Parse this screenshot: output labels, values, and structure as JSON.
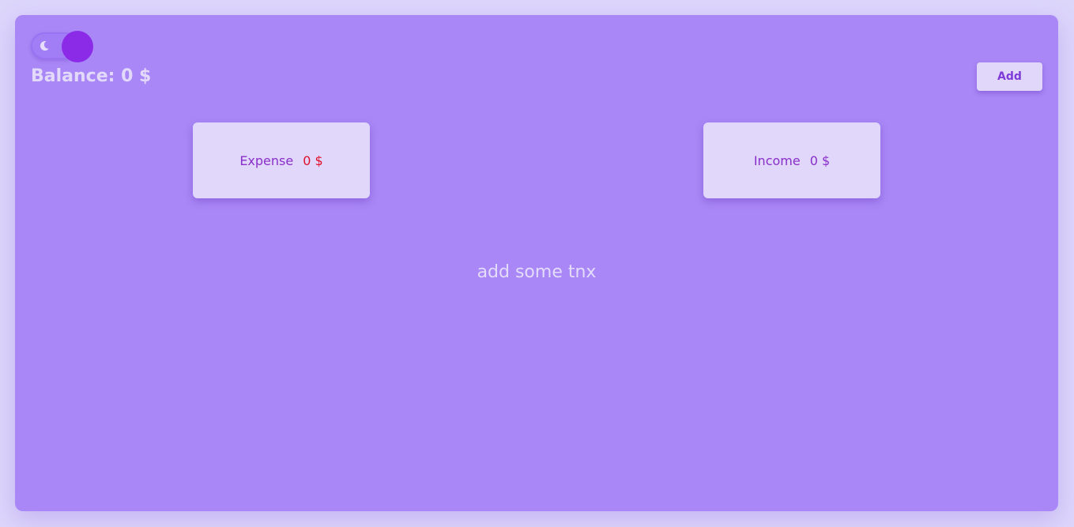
{
  "theme_toggle": {
    "icon": "moon-icon",
    "state": "dark"
  },
  "balance": {
    "text": "Balance: 0 $"
  },
  "add_button": {
    "label": "Add"
  },
  "cards": {
    "expense": {
      "label": "Expense",
      "value": "0 $"
    },
    "income": {
      "label": "Income",
      "value": "0 $"
    }
  },
  "empty_state": {
    "text": "add some tnx"
  },
  "colors": {
    "page_bg": "#ddd6fb",
    "panel_bg": "#a987f6",
    "card_bg": "#e0d7fa",
    "accent": "#8b2be8",
    "expense_value": "#e0112b"
  }
}
